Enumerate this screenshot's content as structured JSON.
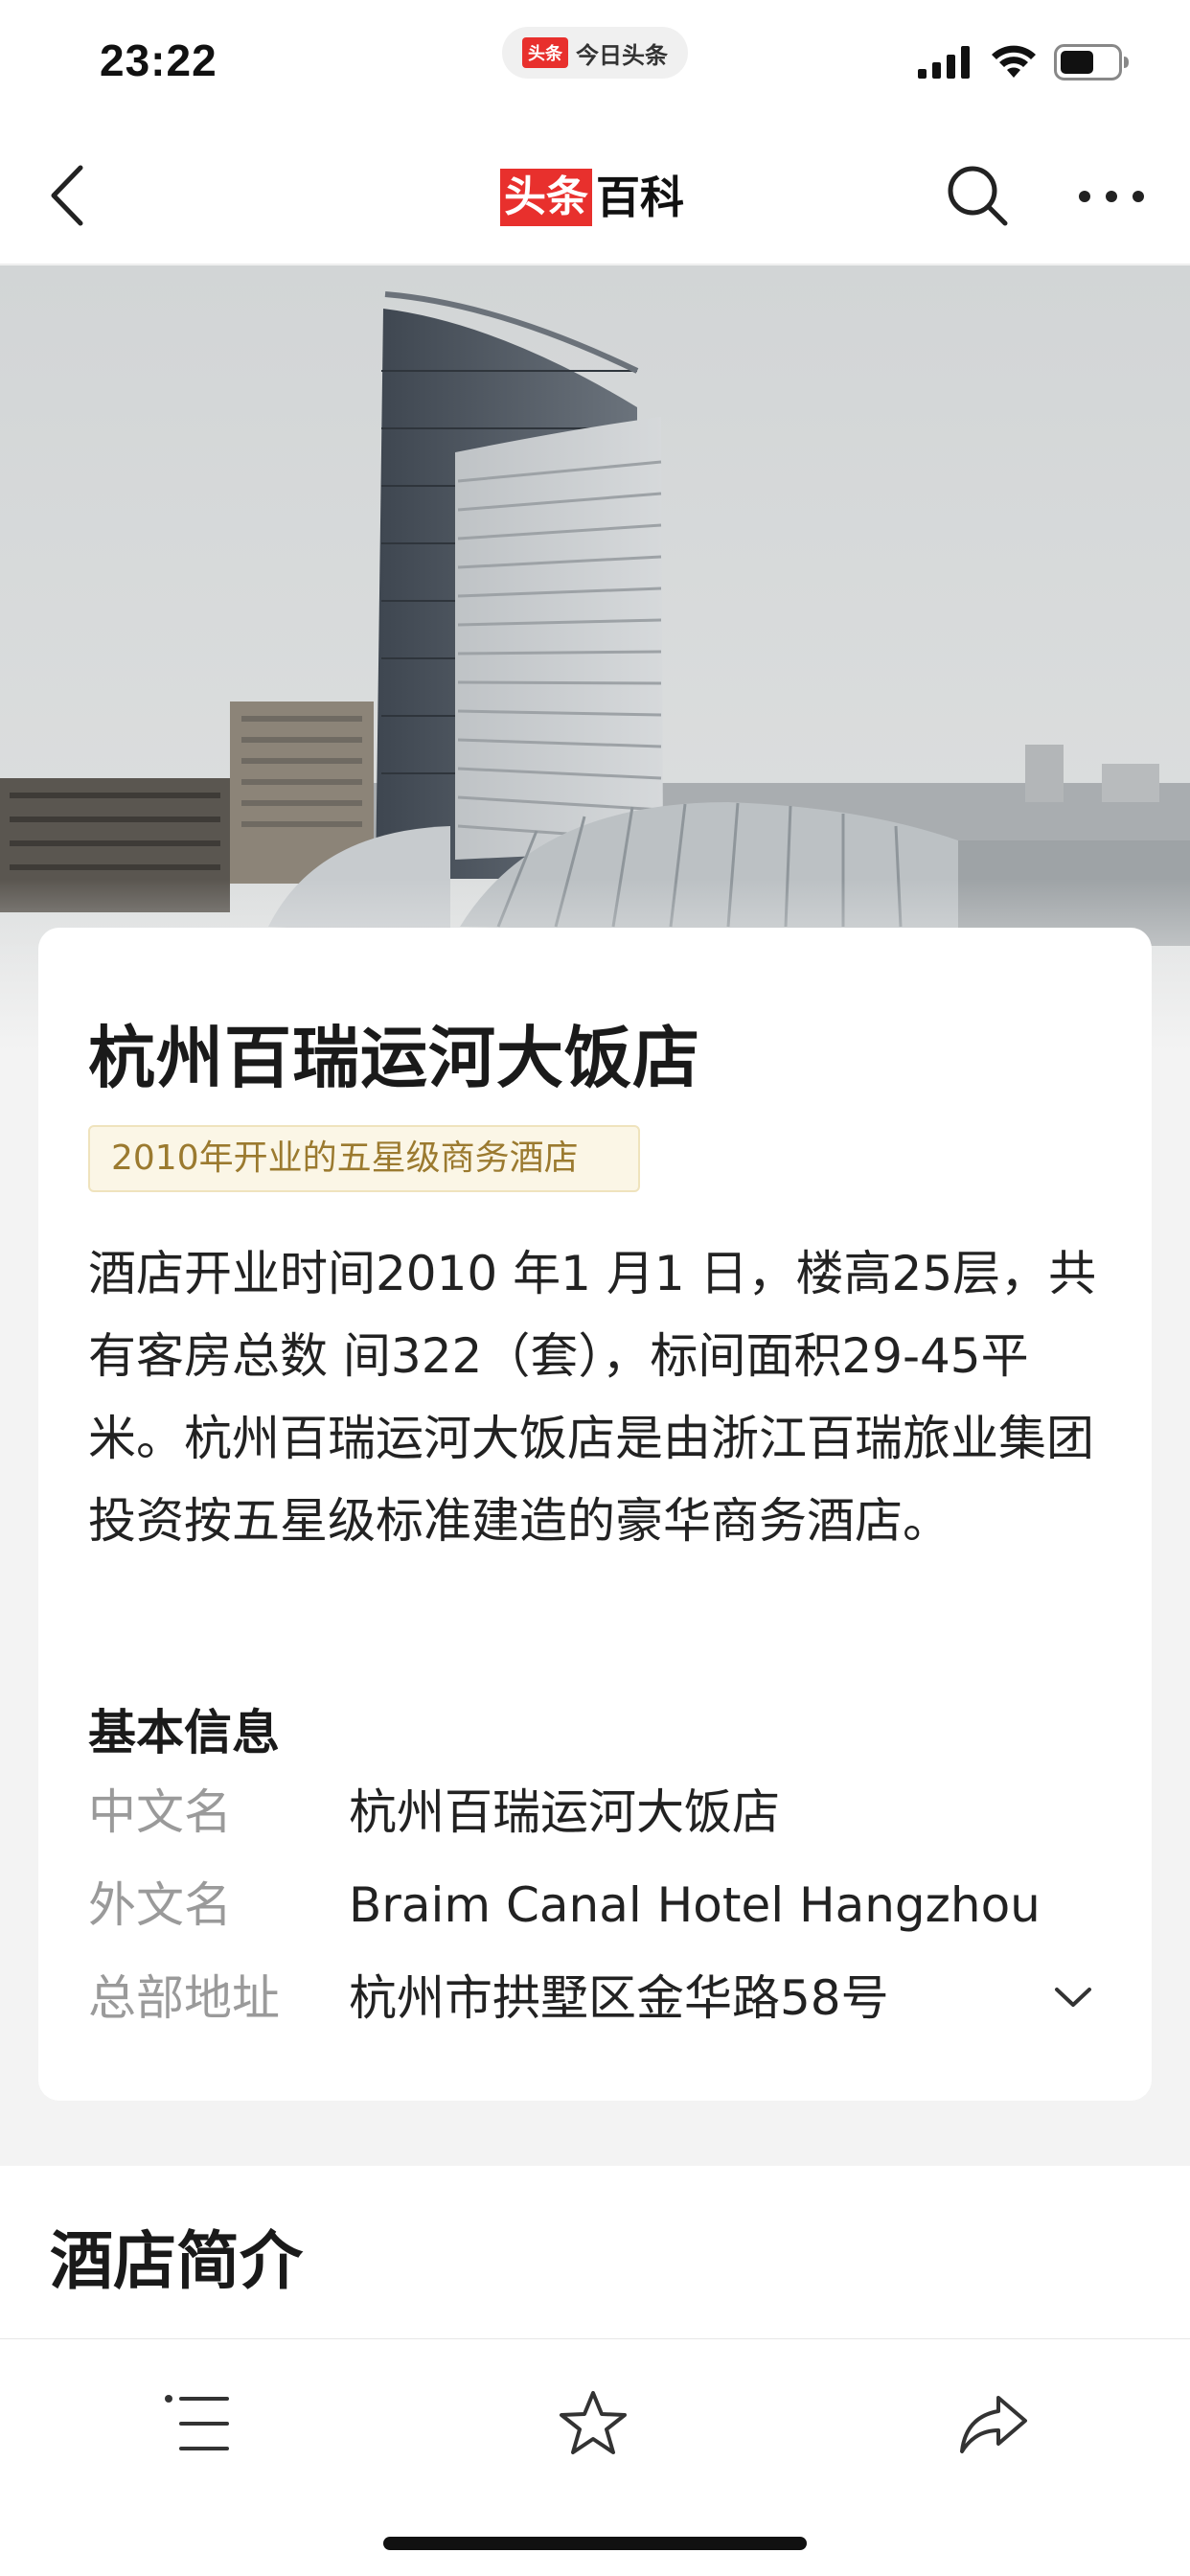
{
  "status_bar": {
    "time": "23:22",
    "app_logo": "头条",
    "app_name": "今日头条",
    "icons": [
      "signal-icon",
      "wifi-icon",
      "battery-icon"
    ]
  },
  "nav": {
    "brand_red": "头条",
    "brand_black": "百科",
    "icons": [
      "back-icon",
      "search-icon",
      "more-icon"
    ]
  },
  "hero": {
    "image": "photo of tall glass hotel tower with curved roof structures"
  },
  "entry": {
    "title": "杭州百瑞运河大饭店",
    "tag": "2010年开业的五星级商务酒店",
    "summary": "酒店开业时间2010 年1 月1 日，楼高25层，共有客房总数 间322（套），标间面积29-45平米。杭州百瑞运河大饭店是由浙江百瑞旅业集团投资按五星级标准建造的豪华商务酒店。"
  },
  "basic_info": {
    "heading": "基本信息",
    "rows": [
      {
        "label": "中文名",
        "value": "杭州百瑞运河大饭店"
      },
      {
        "label": "外文名",
        "value": "Braim Canal Hotel Hangzhou"
      },
      {
        "label": "总部地址",
        "value": "杭州市拱墅区金华路58号"
      }
    ]
  },
  "section": {
    "title": "酒店简介"
  },
  "bottom_bar": {
    "icons": [
      "menu-icon",
      "star-icon",
      "share-icon"
    ]
  },
  "colors": {
    "brand_red": "#e8302d",
    "tag_bg": "#fbf6e6",
    "tag_text": "#9b7a2f",
    "label_gray": "#9a9a9a"
  }
}
